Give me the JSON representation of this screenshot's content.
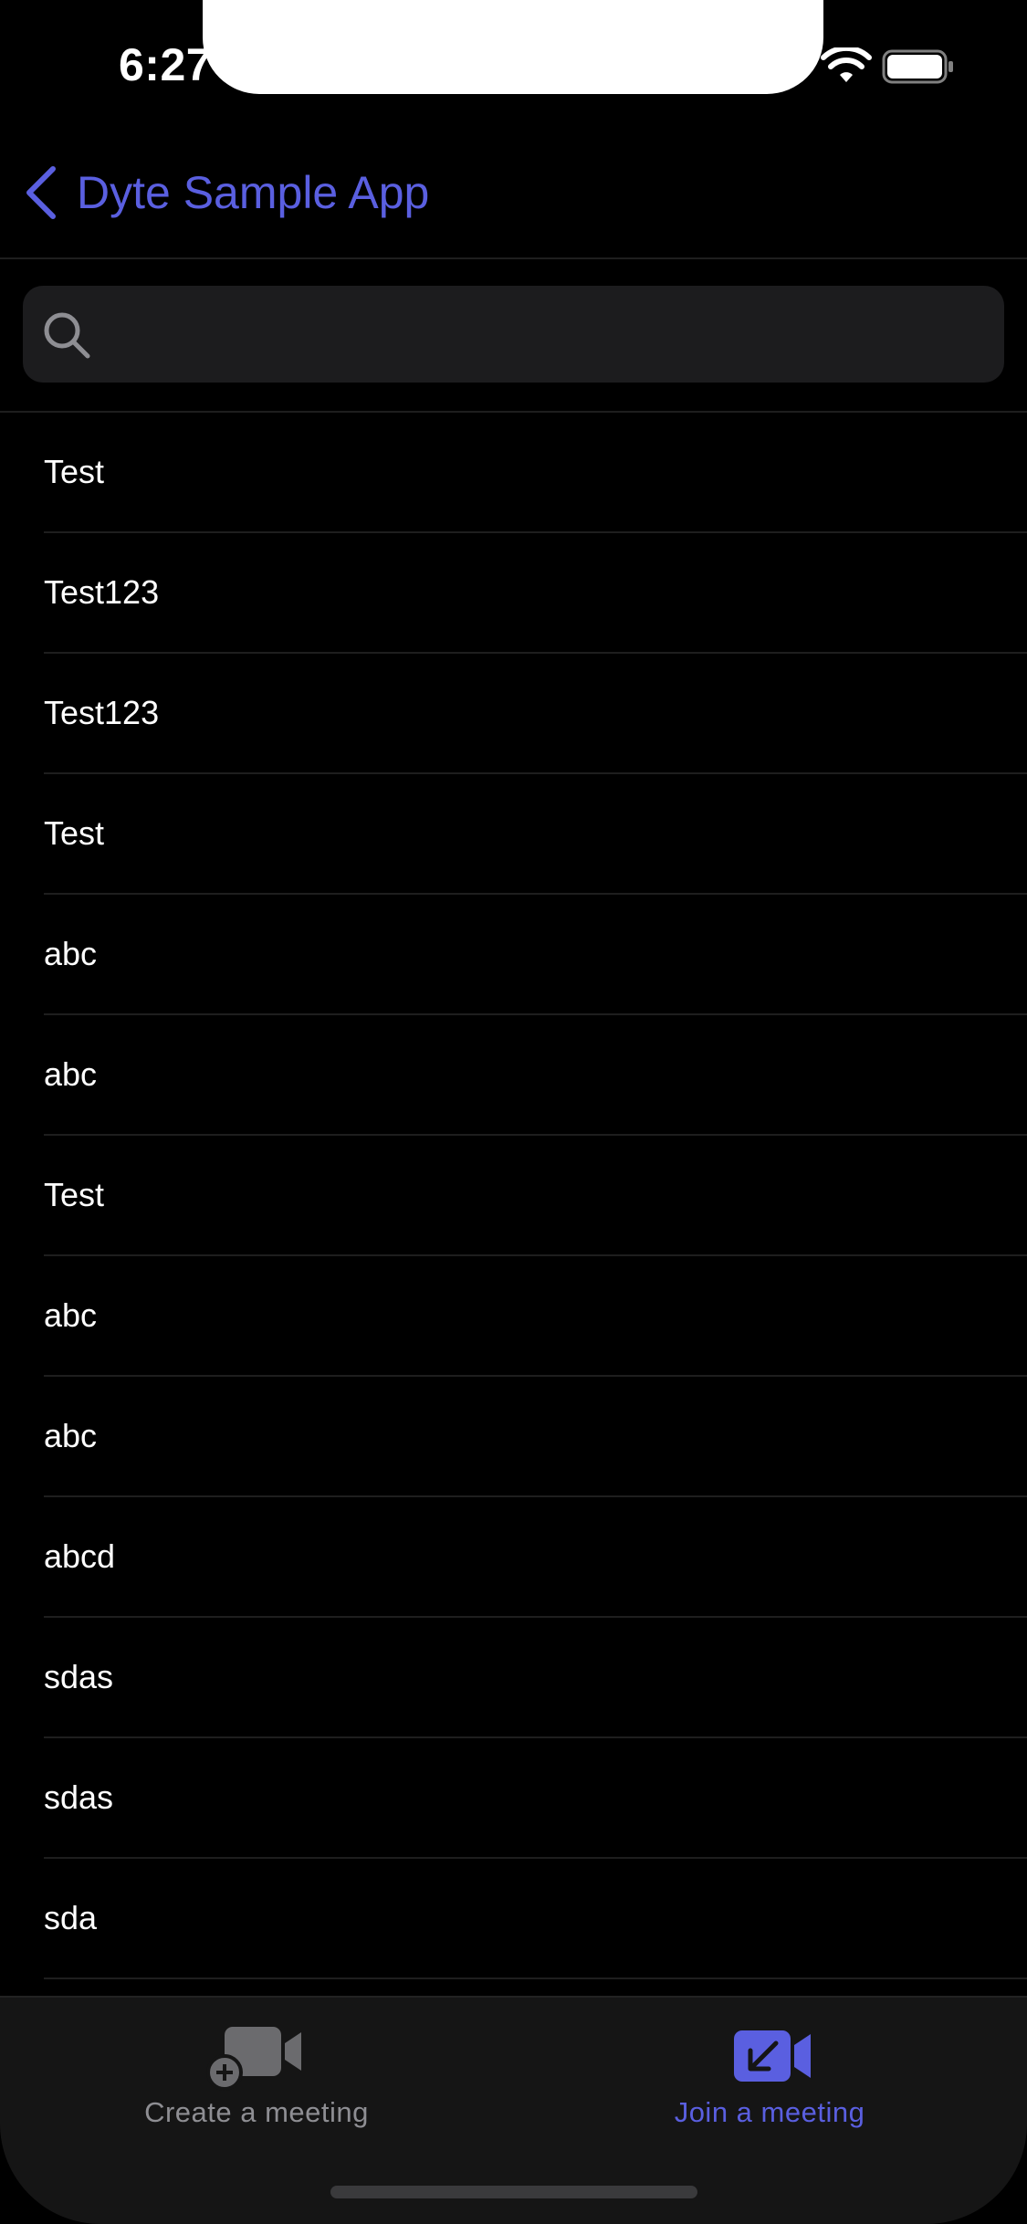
{
  "status_bar": {
    "time": "6:27"
  },
  "nav": {
    "back_label": "Dyte Sample App"
  },
  "search": {
    "placeholder": "",
    "value": ""
  },
  "list": {
    "items": [
      "Test",
      "Test123",
      "Test123",
      "Test",
      "abc",
      "abc",
      "Test",
      "abc",
      "abc",
      "abcd",
      "sdas",
      "sdas",
      "sda"
    ]
  },
  "tab_bar": {
    "tabs": [
      {
        "label": "Create a meeting",
        "icon": "video-add-icon",
        "selected": false
      },
      {
        "label": "Join a meeting",
        "icon": "video-join-icon",
        "selected": true
      }
    ]
  },
  "colors": {
    "accent": "#5a5fe0",
    "background": "#000000",
    "tab_bar": "#151515",
    "inactive": "#8e8e93"
  }
}
